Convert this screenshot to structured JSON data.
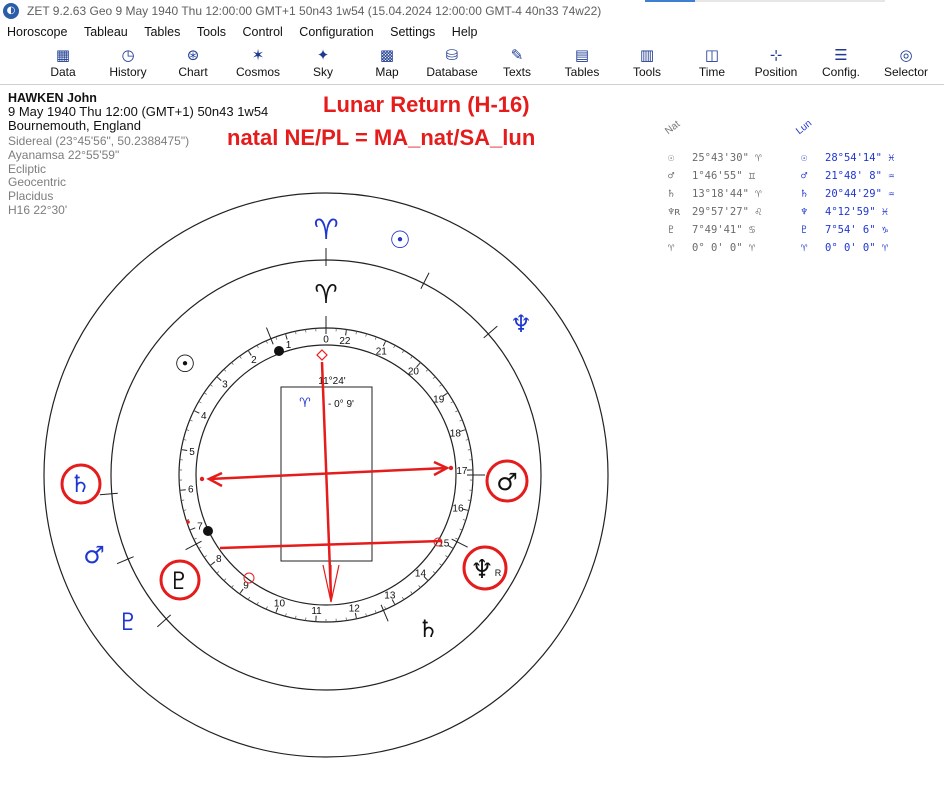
{
  "titlebar": {
    "app_icon": "zet-app-icon",
    "text": "ZET 9.2.63 Geo    9 May 1940  Thu  12:00:00 GMT+1 50n43  1w54  (15.04.2024  12:00:00 GMT-4 40n33 74w22)"
  },
  "menu": [
    "Horoscope",
    "Tableau",
    "Tables",
    "Tools",
    "Control",
    "Configuration",
    "Settings",
    "Help"
  ],
  "toolbar": [
    {
      "label": "Data",
      "icon": "data-grid-icon",
      "glyph": "▦"
    },
    {
      "label": "History",
      "icon": "history-icon",
      "glyph": "◷"
    },
    {
      "label": "Chart",
      "icon": "chart-wheel-icon",
      "glyph": "⊛"
    },
    {
      "label": "Cosmos",
      "icon": "cosmos-icon",
      "glyph": "✶"
    },
    {
      "label": "Sky",
      "icon": "sky-icon",
      "glyph": "✦"
    },
    {
      "label": "Map",
      "icon": "map-icon",
      "glyph": "▩"
    },
    {
      "label": "Database",
      "icon": "database-icon",
      "glyph": "⛁"
    },
    {
      "label": "Texts",
      "icon": "texts-icon",
      "glyph": "✎"
    },
    {
      "label": "Tables",
      "icon": "tables-icon",
      "glyph": "▤"
    },
    {
      "label": "Tools",
      "icon": "tools-icon",
      "glyph": "▥"
    },
    {
      "label": "Time",
      "icon": "time-icon",
      "glyph": "◫"
    },
    {
      "label": "Position",
      "icon": "position-icon",
      "glyph": "⊹"
    },
    {
      "label": "Config.",
      "icon": "config-icon",
      "glyph": "☰"
    },
    {
      "label": "Selector",
      "icon": "selector-icon",
      "glyph": "◎"
    }
  ],
  "info": {
    "name": "HAWKEN John",
    "date_line": "9 May 1940  Thu  12:00 (GMT+1) 50n43  1w54",
    "place": "Bournemouth, England",
    "details": [
      "Sidereal (23°45'56\", 50.2388475\")",
      "Ayanamsa 22°55'59\"",
      "Ecliptic",
      "Geocentric",
      "Placidus",
      "H16  22°30'"
    ]
  },
  "annotation": {
    "line1": "Lunar Return (H-16)",
    "line2": "natal NE/PL = MA_nat/SA_lun",
    "color": "#e51c1c"
  },
  "positions": {
    "nat_header": "Nat",
    "lun_header": "Lun",
    "rows": [
      {
        "nat_glyph": "☉",
        "nat_pos": "25°43'30\" ♈",
        "lun_glyph": "☉",
        "lun_pos": "28°54'14\" ♓"
      },
      {
        "nat_glyph": "♂",
        "nat_pos": " 1°46'55\" ♊",
        "lun_glyph": "♂",
        "lun_pos": "21°48' 8\" ♒"
      },
      {
        "nat_glyph": "♄",
        "nat_pos": "13°18'44\" ♈",
        "lun_glyph": "♄",
        "lun_pos": "20°44'29\" ♒"
      },
      {
        "nat_glyph": "♆ʀ",
        "nat_pos": "29°57'27\" ♌",
        "lun_glyph": "♆",
        "lun_pos": " 4°12'59\" ♓"
      },
      {
        "nat_glyph": "♇",
        "nat_pos": " 7°49'41\" ♋",
        "lun_glyph": "♇",
        "lun_pos": " 7°54' 6\" ♑"
      },
      {
        "nat_glyph": "♈",
        "nat_pos": " 0° 0' 0\" ♈",
        "lun_glyph": "♈",
        "lun_pos": " 0° 0' 0\" ♈"
      }
    ],
    "nat_color": "#6b6b6b",
    "lun_color": "#1f37d0"
  },
  "wheel": {
    "dial_numbers": [
      "22",
      "21",
      "20",
      "19",
      "18",
      "17",
      "16",
      "15",
      "14",
      "13",
      "12",
      "11",
      "10",
      "9",
      "8",
      "7",
      "6",
      "5",
      "4",
      "3",
      "2",
      "1",
      "0"
    ],
    "center_top_label": "11°24'",
    "center_offset_label": "- 0° 9'",
    "center_symbol": "♈",
    "outer_glyphs": {
      "aries": "♈",
      "sun": "☉",
      "neptune": "♆",
      "saturn": "♄",
      "mars": "♂",
      "pluto": "♇"
    },
    "inner_glyphs": {
      "aries": "♈",
      "sun": "☉",
      "saturn": "♄",
      "mars": "♂",
      "neptune": "♆",
      "pluto": "♇",
      "retro": "R"
    },
    "colors": {
      "outer": "#1f37d0",
      "inner": "#111111",
      "highlight": "#e51c1c"
    }
  }
}
